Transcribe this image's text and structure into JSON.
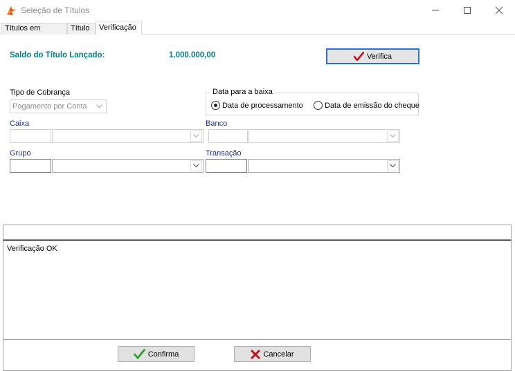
{
  "window": {
    "title": "Seleção de Títulos"
  },
  "tabs": [
    {
      "label": "Títulos em Aberto",
      "active": false
    },
    {
      "label": "Título",
      "active": false
    },
    {
      "label": "Verificação",
      "active": true
    }
  ],
  "saldo": {
    "label": "Saldo do Título Lançado:",
    "value": "1.000.000,00"
  },
  "verifica_button": {
    "label": "Verifica"
  },
  "tipo_cobranca": {
    "label": "Tipo de Cobrança",
    "value": "Pagamento por Conta"
  },
  "data_baixa": {
    "label": "Data para a baixa",
    "options": [
      {
        "label": "Data de processamento",
        "checked": true
      },
      {
        "label": "Data de emissão do cheque",
        "checked": false
      }
    ]
  },
  "caixa": {
    "label": "Caixa"
  },
  "banco": {
    "label": "Banco"
  },
  "grupo": {
    "label": "Grupo"
  },
  "transacao": {
    "label": "Transação"
  },
  "log": {
    "text": "Verificação OK"
  },
  "footer": {
    "confirm_label": "Confirma",
    "cancel_label": "Cancelar"
  },
  "colors": {
    "teal": "#00808a",
    "label_blue": "#1a2c8f",
    "check_red": "#c8101e",
    "check_green": "#2e9c2e",
    "cross_red": "#c0141c",
    "focus_blue": "#2a6fd6"
  }
}
